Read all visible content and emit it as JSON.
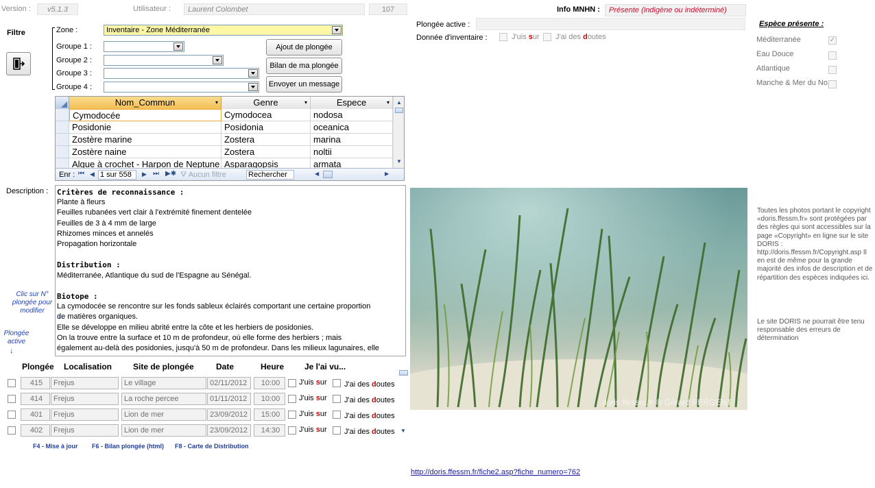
{
  "top": {
    "version_label": "Version :",
    "version_value": "v5.1.3",
    "user_label": "Utilisateur :",
    "user_value": "Laurent Colombet",
    "user_number": "107",
    "info_label": "Info MNHN :",
    "info_value": "Présente (indigène ou indéterminé)"
  },
  "filter": {
    "title": "Filtre",
    "zone_label": "Zone  :",
    "zone_value": "Inventaire - Zone Méditerranée",
    "group1_label": "Groupe 1 :",
    "group2_label": "Groupe 2 :",
    "group3_label": "Groupe 3 :",
    "group4_label": "Groupe 4 :"
  },
  "buttons": {
    "add_dive": "Ajout de plongée",
    "dive_report": "Bilan de ma plongée",
    "send_message": "Envoyer un message"
  },
  "dive_info": {
    "active_label": "Plongée active :",
    "inventory_label": "Donnée d'inventaire :",
    "sure_prefix": "J'uis ",
    "sure_emph": "s",
    "sure_suffix": "ur",
    "doubt_prefix": "J'ai des ",
    "doubt_emph": "d",
    "doubt_suffix": "outes"
  },
  "species_present": {
    "title": "Espèce présente :",
    "items": [
      {
        "label": "Méditerranée",
        "checked": true
      },
      {
        "label": "Eau Douce",
        "checked": false
      },
      {
        "label": "Atlantique",
        "checked": false
      },
      {
        "label": "Manche & Mer du No",
        "checked": false
      }
    ]
  },
  "grid": {
    "columns": [
      "Nom_Commun",
      "Genre",
      "Espece"
    ],
    "rows": [
      [
        "Cymodocée",
        "Cymodocea",
        "nodosa"
      ],
      [
        "Posidonie",
        "Posidonia",
        "oceanica"
      ],
      [
        "Zostère marine",
        "Zostera",
        "marina"
      ],
      [
        "Zostère naine",
        "Zostera",
        "noltii"
      ],
      [
        "Algue à crochet - Harpon de Neptune",
        "Asparagopsis",
        "armata"
      ]
    ],
    "nav_label": "Enr :",
    "nav_position": "1 sur 558",
    "no_filter": "Aucun filtre",
    "search": "Rechercher"
  },
  "description": {
    "label": "Description :",
    "lines": [
      {
        "text": "Critères de reconnaissance :",
        "style": "mono"
      },
      {
        "text": "Plante à fleurs",
        "style": ""
      },
      {
        "text": "Feuilles rubanées vert clair à l'extrémité finement dentelée",
        "style": ""
      },
      {
        "text": "Feuilles de 3 à 4 mm de large",
        "style": ""
      },
      {
        "text": "Rhizomes minces et annelés",
        "style": ""
      },
      {
        "text": "Propagation horizontale",
        "style": ""
      },
      {
        "text": "",
        "style": ""
      },
      {
        "text": "Distribution :",
        "style": "mono"
      },
      {
        "text": "Méditerranée, Atlantique du sud de l'Espagne au Sénégal.",
        "style": ""
      },
      {
        "text": "",
        "style": ""
      },
      {
        "text": "Biotope :",
        "style": "mono"
      },
      {
        "text": "La cymodocée se rencontre sur les fonds sableux éclairés comportant une certaine proportion",
        "style": ""
      },
      {
        "text": "de matières organiques.",
        "style": ""
      },
      {
        "text": "Elle se développe en milieu abrité entre la côte et les herbiers de posidonies.",
        "style": ""
      },
      {
        "text": "On la trouve entre la surface et 10 m de profondeur, où elle forme des herbiers ; mais",
        "style": ""
      },
      {
        "text": "également au-delà des posidonies, jusqu'à 50 m de profondeur. Dans les milieux lagunaires, elle",
        "style": ""
      }
    ]
  },
  "notes": {
    "click_note": "Clic sur N° plongée pour modifier",
    "active_note": "Plongée active"
  },
  "dives": {
    "headers": [
      "Plongée",
      "Localisation",
      "Site de plongée",
      "Date",
      "Heure",
      "Je l'ai vu..."
    ],
    "rows": [
      {
        "num": "415",
        "loc": "Frejus",
        "site": "Le village",
        "date": "02/11/2012",
        "time": "10:00"
      },
      {
        "num": "414",
        "loc": "Frejus",
        "site": "La roche percee",
        "date": "01/11/2012",
        "time": "10:00"
      },
      {
        "num": "401",
        "loc": "Frejus",
        "site": "Lion de mer",
        "date": "23/09/2012",
        "time": "15:00"
      },
      {
        "num": "402",
        "loc": "Frejus",
        "site": "Lion de mer",
        "date": "23/09/2012",
        "time": "14:30"
      }
    ]
  },
  "fkeys": {
    "f4": "F4 - Mise à jour",
    "f6": "F6 - Bilan plongée (html)",
    "f8": "F8 - Carte de Distribution"
  },
  "photo": {
    "credit": "doris.ffessm.fr  ©  Gérard PERGENT"
  },
  "copyright": {
    "text1": "Toutes les photos portant le copyright «doris.ffessm.fr» sont protégées par des règles qui sont accessibles sur la page «Copyright» en ligne sur le site DORIS : http://doris.ffessm.fr/Copyright.asp Il en est de même pour la grande majorité des infos de description et de répartition des espèces indiquées ici.",
    "text2": "Le site DORIS ne pourrait être tenu responsable des erreurs de détermination"
  },
  "link": "http://doris.ffessm.fr/fiche2.asp?fiche_numero=762"
}
